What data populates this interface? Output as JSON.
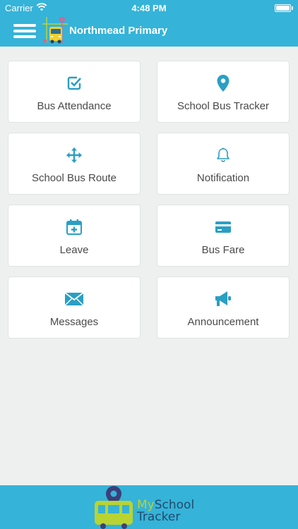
{
  "status_bar": {
    "carrier": "Carrier",
    "time": "4:48 PM"
  },
  "header": {
    "title": "Northmead Primary"
  },
  "tiles": [
    {
      "label": "Bus Attendance",
      "icon": "checkbox-icon"
    },
    {
      "label": "School Bus Tracker",
      "icon": "location-pin-icon"
    },
    {
      "label": "School Bus Route",
      "icon": "move-arrows-icon"
    },
    {
      "label": "Notification",
      "icon": "bell-icon"
    },
    {
      "label": "Leave",
      "icon": "calendar-plus-icon"
    },
    {
      "label": "Bus Fare",
      "icon": "credit-card-icon"
    },
    {
      "label": "Messages",
      "icon": "envelope-icon"
    },
    {
      "label": "Announcement",
      "icon": "megaphone-icon"
    }
  ],
  "footer": {
    "brand_my": "My",
    "brand_school": "School",
    "brand_tracker": "Tracker"
  },
  "colors": {
    "primary": "#35b3d9",
    "icon": "#2a9fc4",
    "background": "#eef0f0",
    "label": "#4a4a4a"
  }
}
